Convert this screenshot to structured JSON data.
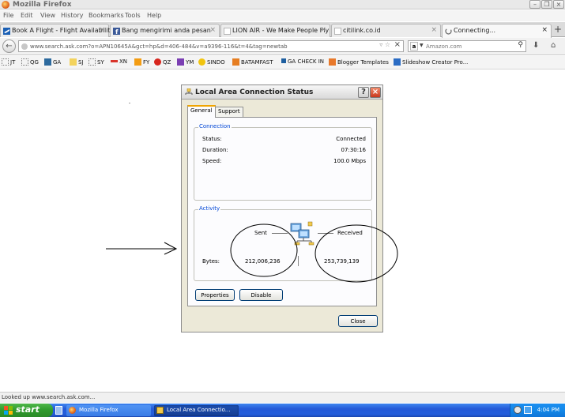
{
  "window": {
    "title": "Mozilla Firefox"
  },
  "menu": [
    "File",
    "Edit",
    "View",
    "History",
    "Bookmarks",
    "Tools",
    "Help"
  ],
  "tabs": [
    {
      "label": "Book A Flight - Flight Availabilit...",
      "icon": "airline-icon"
    },
    {
      "label": "Bang mengirimi anda pesan",
      "icon": "facebook-icon"
    },
    {
      "label": "LION AIR - We Make People Fly",
      "icon": "blank-page-icon"
    },
    {
      "label": "citilink.co.id",
      "icon": "blank-page-icon"
    },
    {
      "label": "Connecting...",
      "icon": "loading-icon"
    }
  ],
  "nav": {
    "url": "www.search.ask.com?o=APN10645A&gct=hp&d=406-484&v=a9396-116&t=4&tag=newtab",
    "search_engine": "a",
    "search_placeholder": "Amazon.com"
  },
  "bookmarks": [
    "JT",
    "QG",
    "GA",
    "SJ",
    "SY",
    "XN",
    "FY",
    "QZ",
    "YM",
    "SINDO",
    "BATAMFAST",
    "GA CHECK IN",
    "Blogger Templates",
    "Slideshow Creator Pro..."
  ],
  "dialog": {
    "title": "Local Area Connection Status",
    "help": "?",
    "close": "×",
    "tabs": [
      "General",
      "Support"
    ],
    "connection": {
      "group_label": "Connection",
      "status_label": "Status:",
      "status_value": "Connected",
      "duration_label": "Duration:",
      "duration_value": "07:30:16",
      "speed_label": "Speed:",
      "speed_value": "100.0 Mbps"
    },
    "activity": {
      "group_label": "Activity",
      "sent_label": "Sent",
      "received_label": "Received",
      "bytes_label": "Bytes:",
      "bytes_sent": "212,006,236",
      "bytes_received": "253,739,139"
    },
    "buttons": {
      "properties": "Properties",
      "disable": "Disable",
      "close": "Close"
    }
  },
  "status_bar": "Looked up www.search.ask.com...",
  "taskbar": {
    "start": "start",
    "tasks": [
      "Mozilla Firefox",
      "Local Area Connectio..."
    ],
    "clock": "4:04 PM"
  },
  "colors": {
    "accent_blue": "#0046d5",
    "taskbar_blue": "#245edb",
    "start_green": "#2f9a2c",
    "dialog_bg": "#ece9d8"
  }
}
